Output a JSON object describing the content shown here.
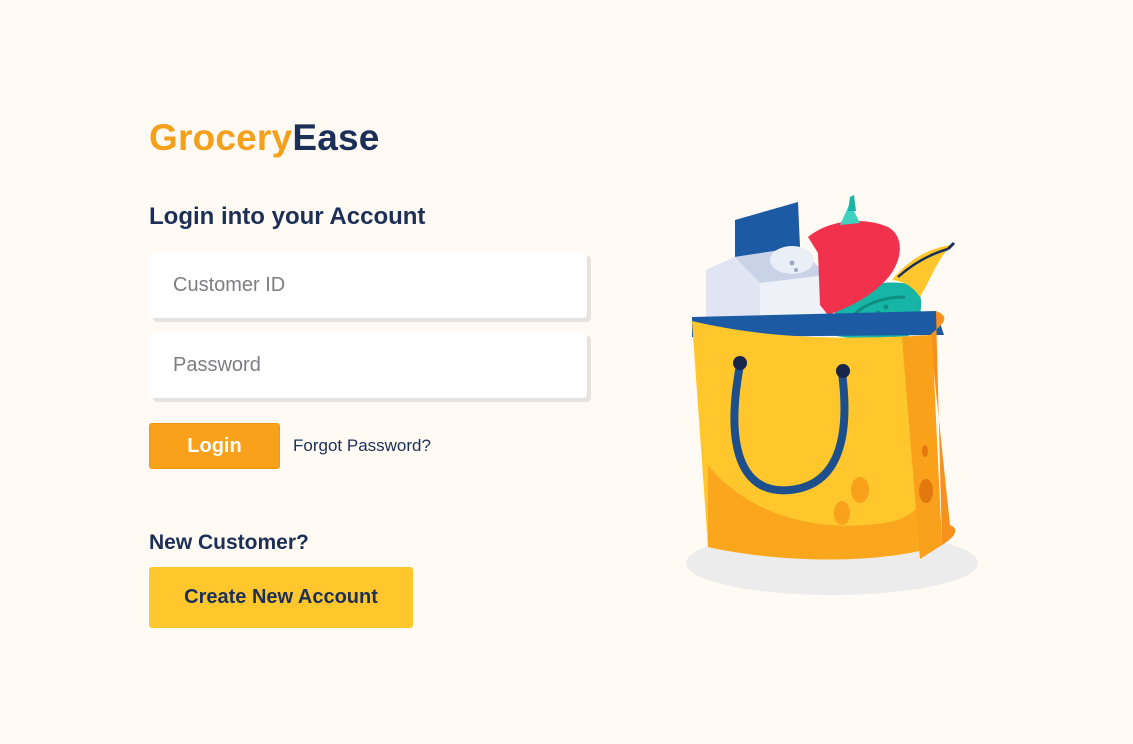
{
  "brand": {
    "part1": "Grocery",
    "part2": "Ease",
    "part1_color": "#f5a01a",
    "part2_color": "#1b2f57"
  },
  "login": {
    "heading": "Login into your Account",
    "customer_id_placeholder": "Customer ID",
    "customer_id_value": "",
    "password_placeholder": "Password",
    "password_value": "",
    "login_label": "Login",
    "forgot_label": "Forgot Password?"
  },
  "signup": {
    "prompt": "New Customer?",
    "create_label": "Create New Account"
  },
  "illustration": {
    "icon": "grocery-bag-icon"
  },
  "colors": {
    "background": "#fffaf3",
    "login_button": "#f9a11b",
    "create_button": "#ffc72c",
    "text": "#1b2f57"
  }
}
